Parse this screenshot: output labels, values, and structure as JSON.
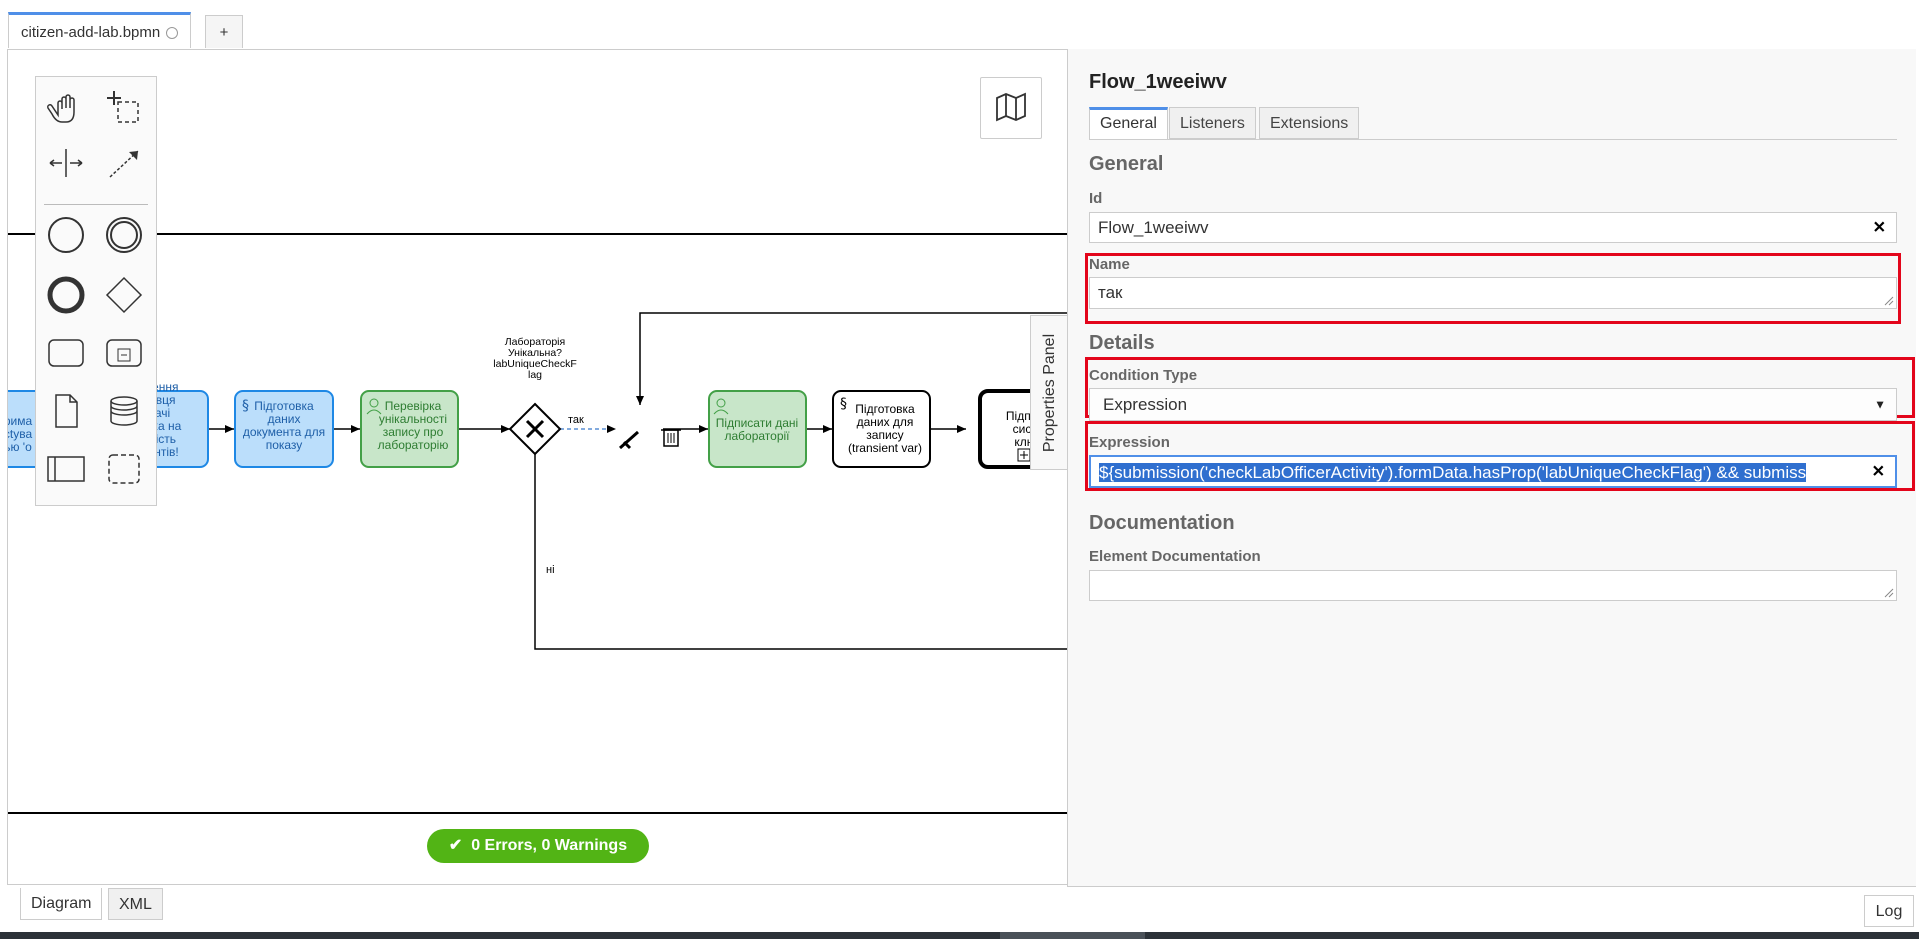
{
  "tabs": {
    "file_name": "citizen-add-lab.bpmn",
    "add_label": "+"
  },
  "diagram": {
    "tasks": [
      {
        "text_lines": [
          "рима",
          "ctyва",
          "ью 'о"
        ]
      },
      {
        "text_lines": [
          "ечення",
          "навця",
          "дачі",
          "вірка на",
          "дність",
          "ментів!"
        ]
      },
      {
        "text_lines": [
          "Підготовка",
          "даних",
          "документа для",
          "показу"
        ]
      },
      {
        "text_lines": [
          "Перевірка",
          "унікальності",
          "запису про",
          "лабораторію"
        ]
      },
      {
        "text_lines": [
          "Підписати дані",
          "лабораторії"
        ]
      },
      {
        "text_lines": [
          "Підготовка",
          "даних для",
          "запису",
          "(transient var)"
        ]
      },
      {
        "text_lines": [
          "Підписа",
          "систе",
          "ключ"
        ]
      }
    ],
    "gateway_label_lines": [
      "Лабораторія",
      "Унікальна?",
      "labUniqueCheckF",
      "lag"
    ],
    "flow_yes": "так",
    "flow_no": "ні"
  },
  "linting": {
    "label": "0 Errors, 0 Warnings"
  },
  "bottom_tabs": {
    "diagram": "Diagram",
    "xml": "XML",
    "log": "Log"
  },
  "properties_toggle": "Properties Panel",
  "panel": {
    "title": "Flow_1weeiwv",
    "tabs": [
      "General",
      "Listeners",
      "Extensions"
    ],
    "group_general": "General",
    "id_label": "Id",
    "id_value": "Flow_1weeiwv",
    "name_label": "Name",
    "name_value": "так",
    "group_details": "Details",
    "condition_type_label": "Condition Type",
    "condition_type_value": "Expression",
    "expression_label": "Expression",
    "expression_value": "${submission('checkLabOfficerActivity').formData.hasProp('labUniqueCheckFlag') && submiss",
    "group_documentation": "Documentation",
    "element_doc_label": "Element Documentation",
    "element_doc_value": ""
  },
  "colors": {
    "highlight": "#e3051b",
    "lint_green": "#52b415",
    "tab_accent": "#4f8fe8",
    "blue_task_fill": "#bbdefb",
    "green_task_fill": "#c8e6c9"
  }
}
